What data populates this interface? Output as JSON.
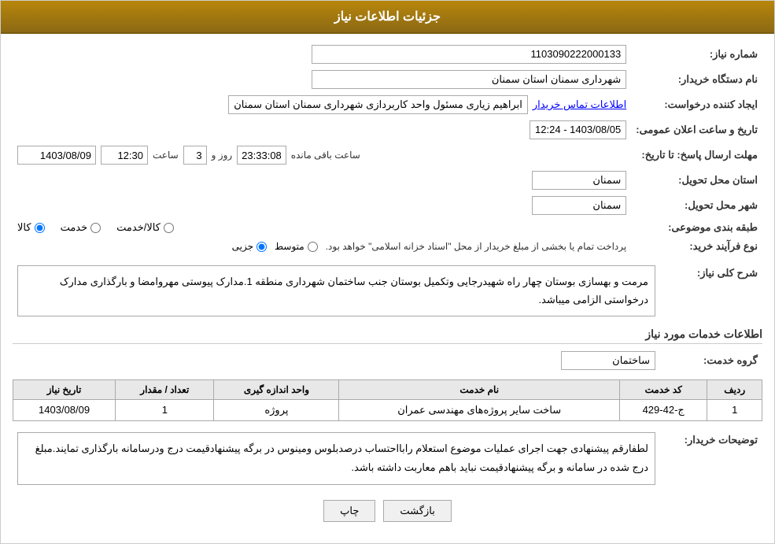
{
  "header": {
    "title": "جزئیات اطلاعات نیاز"
  },
  "fields": {
    "need_number_label": "شماره نیاز:",
    "need_number_value": "1103090222000133",
    "buyer_org_label": "نام دستگاه خریدار:",
    "buyer_org_value": "شهرداری سمنان استان سمنان",
    "creator_label": "ایجاد کننده درخواست:",
    "creator_value": "ابراهیم زیاری مسئول واحد کاربردازی شهرداری سمنان استان سمنان",
    "creator_link": "اطلاعات تماس خریدار",
    "announce_date_label": "تاریخ و ساعت اعلان عمومی:",
    "announce_date_value": "1403/08/05 - 12:24",
    "deadline_label": "مهلت ارسال پاسخ: تا تاریخ:",
    "deadline_date": "1403/08/09",
    "deadline_time": "12:30",
    "deadline_days": "3",
    "deadline_remaining": "23:33:08",
    "deadline_days_label": "روز و",
    "deadline_time_label": "ساعت",
    "deadline_remaining_label": "ساعت باقی مانده",
    "province_label": "استان محل تحویل:",
    "province_value": "سمنان",
    "city_label": "شهر محل تحویل:",
    "city_value": "سمنان",
    "category_label": "طبقه بندی موضوعی:",
    "category_kala": "کالا",
    "category_khadamat": "خدمت",
    "category_kala_khadamat": "کالا/خدمت",
    "process_label": "نوع فرآیند خرید:",
    "process_jozei": "جزیی",
    "process_motavasset": "متوسط",
    "process_description": "پرداخت تمام یا بخشی از مبلغ خریدار از محل \"اسناد خزانه اسلامی\" خواهد بود.",
    "description_label": "شرح کلی نیاز:",
    "description_text": "مرمت و بهسازی بوستان چهار راه شهیدرجایی وتکمیل بوستان جنب ساختمان شهرداری منطقه 1.مدارک پیوستی مهروامضا و بارگذاری مدارک درخواستی الزامی میباشد.",
    "services_header": "اطلاعات خدمات مورد نیاز",
    "service_group_label": "گروه خدمت:",
    "service_group_value": "ساختمان",
    "table_headers": {
      "row": "ردیف",
      "code": "کد خدمت",
      "name": "نام خدمت",
      "unit": "واحد اندازه گیری",
      "count": "تعداد / مقدار",
      "date": "تاریخ نیاز"
    },
    "table_rows": [
      {
        "row": "1",
        "code": "ج-42-429",
        "name": "ساخت سایر پروژه‌های مهندسی عمران",
        "unit": "پروژه",
        "count": "1",
        "date": "1403/08/09"
      }
    ],
    "buyer_notes_label": "توضیحات خریدار:",
    "buyer_notes_text": "لطفارقم پیشنهادی جهت اجرای عملیات موضوع استعلام رابااحتساب درصدبلوس ومینوس در برگه پیشنهادقیمت درج ودرسامانه بارگذاری تمایند.مبلغ درج شده در سامانه و برگه پیشنهادقیمت نباید باهم معاربت داشته باشد.",
    "btn_print": "چاپ",
    "btn_back": "بازگشت"
  }
}
